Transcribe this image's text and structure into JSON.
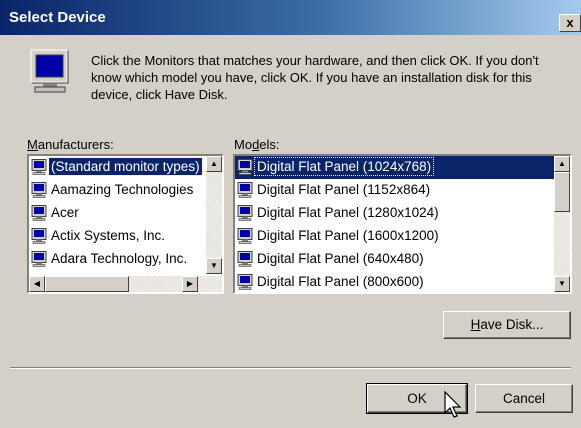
{
  "window": {
    "title": "Select Device",
    "close_glyph": "x"
  },
  "instructions": "Click the Monitors that matches your hardware, and then click OK. If you don't know which model you have, click OK. If you have an installation disk for this device, click Have Disk.",
  "manufacturers": {
    "label_prefix": "M",
    "label_rest": "anufacturers:",
    "items": [
      "(Standard monitor types)",
      "Aamazing Technologies",
      "Acer",
      "Actix Systems, Inc.",
      "Adara Technology, Inc."
    ],
    "selected_index": 0
  },
  "models": {
    "label_pre": "Mo",
    "label_underline": "d",
    "label_rest": "els:",
    "items": [
      "Digital Flat Panel (1024x768)",
      "Digital Flat Panel (1152x864)",
      "Digital Flat Panel (1280x1024)",
      "Digital Flat Panel (1600x1200)",
      "Digital Flat Panel (640x480)",
      "Digital Flat Panel (800x600)"
    ],
    "selected_index": 0
  },
  "buttons": {
    "have_disk_underline": "H",
    "have_disk_rest": "ave Disk...",
    "ok": "OK",
    "cancel": "Cancel"
  },
  "icons": [
    "monitor-icon",
    "arrow-cursor-icon",
    "scroll-up-arrow-icon",
    "scroll-down-arrow-icon",
    "scroll-left-arrow-icon",
    "scroll-right-arrow-icon"
  ]
}
